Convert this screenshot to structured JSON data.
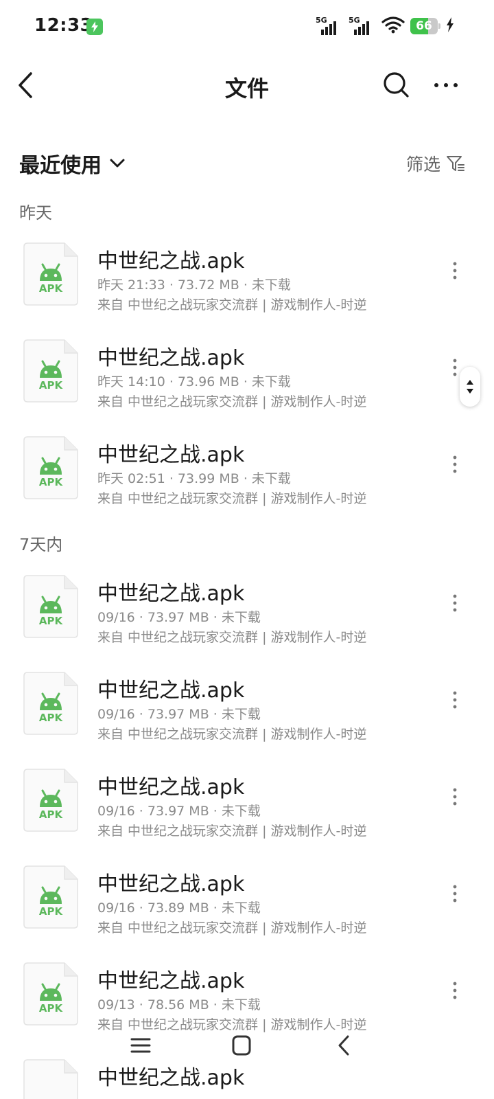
{
  "status_bar": {
    "time": "12:33",
    "signal_labels": [
      "5G",
      "5G"
    ],
    "battery_level": "66"
  },
  "header": {
    "title": "文件"
  },
  "filter_bar": {
    "sort_label": "最近使用",
    "filter_label": "筛选"
  },
  "sections": [
    {
      "label": "昨天",
      "files": [
        {
          "name": "中世纪之战.apk",
          "meta": "昨天 21:33 · 73.72 MB · 未下载",
          "source": "来自 中世纪之战玩家交流群 | 游戏制作人-时逆",
          "badge": "APK"
        },
        {
          "name": "中世纪之战.apk",
          "meta": "昨天 14:10 · 73.96 MB · 未下载",
          "source": "来自 中世纪之战玩家交流群 | 游戏制作人-时逆",
          "badge": "APK"
        },
        {
          "name": "中世纪之战.apk",
          "meta": "昨天 02:51 · 73.99 MB · 未下载",
          "source": "来自 中世纪之战玩家交流群 | 游戏制作人-时逆",
          "badge": "APK"
        }
      ]
    },
    {
      "label": "7天内",
      "files": [
        {
          "name": "中世纪之战.apk",
          "meta": "09/16 · 73.97 MB · 未下载",
          "source": "来自 中世纪之战玩家交流群 | 游戏制作人-时逆",
          "badge": "APK"
        },
        {
          "name": "中世纪之战.apk",
          "meta": "09/16 · 73.97 MB · 未下载",
          "source": "来自 中世纪之战玩家交流群 | 游戏制作人-时逆",
          "badge": "APK"
        },
        {
          "name": "中世纪之战.apk",
          "meta": "09/16 · 73.97 MB · 未下载",
          "source": "来自 中世纪之战玩家交流群 | 游戏制作人-时逆",
          "badge": "APK"
        },
        {
          "name": "中世纪之战.apk",
          "meta": "09/16 · 73.89 MB · 未下载",
          "source": "来自 中世纪之战玩家交流群 | 游戏制作人-时逆",
          "badge": "APK"
        },
        {
          "name": "中世纪之战.apk",
          "meta": "09/13 · 78.56 MB · 未下载",
          "source": "来自 中世纪之战玩家交流群 | 游戏制作人-时逆",
          "badge": "APK"
        },
        {
          "name": "中世纪之战.apk",
          "meta": "",
          "source": "",
          "badge": ""
        }
      ]
    }
  ],
  "icons": {
    "file_type": "android-apk-icon",
    "more": "more-vertical-icon",
    "back": "chevron-left-icon",
    "search": "search-icon",
    "overflow": "more-horizontal-icon",
    "filter": "filter-icon"
  },
  "colors": {
    "accent_green": "#4cc55d",
    "apk_green": "#5cb85c",
    "text_primary": "#1a1a1a",
    "text_secondary": "#8a8a8a",
    "battery_green": "#3fc24b"
  }
}
